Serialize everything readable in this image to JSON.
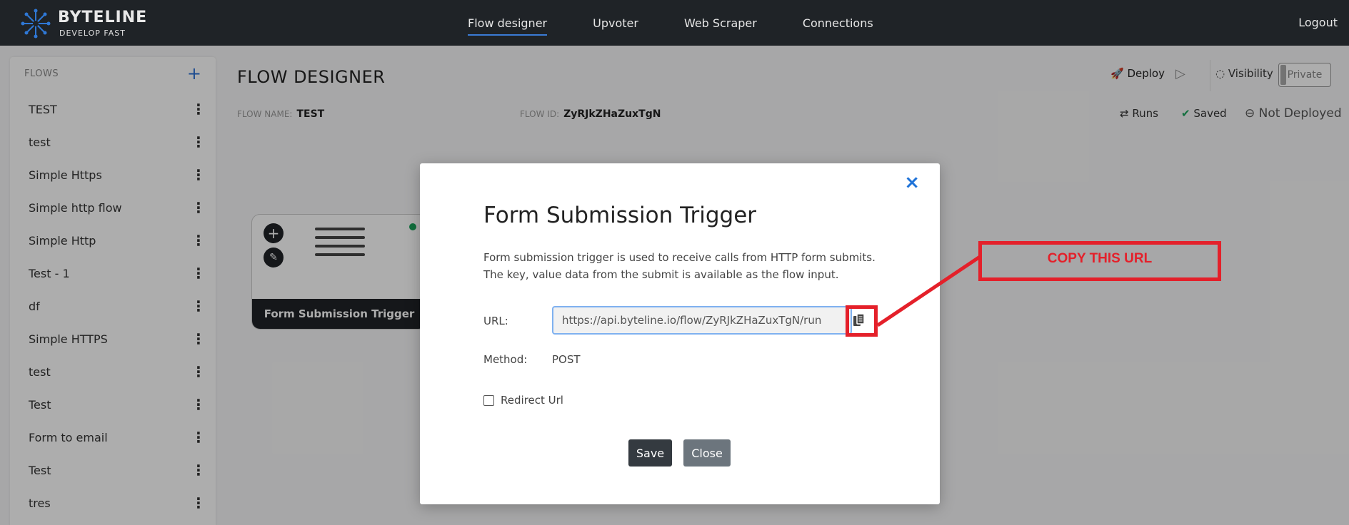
{
  "app": {
    "brand": "BYTELINE",
    "tagline": "DEVELOP FAST"
  },
  "nav": {
    "items": [
      {
        "label": "Flow designer",
        "active": true
      },
      {
        "label": "Upvoter",
        "active": false
      },
      {
        "label": "Web Scraper",
        "active": false
      },
      {
        "label": "Connections",
        "active": false
      }
    ],
    "logout": "Logout"
  },
  "sidebar": {
    "heading": "FLOWS",
    "add": "+",
    "flows": [
      "TEST",
      "test",
      "Simple Https",
      "Simple http flow",
      "Simple Http",
      "Test - 1",
      "df",
      "Simple HTTPS",
      "test",
      "Test",
      "Form to email",
      "Test",
      "tres"
    ]
  },
  "designer": {
    "title": "FLOW DESIGNER",
    "flow_name_label": "FLOW NAME:",
    "flow_name": "TEST",
    "flow_id_label": "FLOW ID:",
    "flow_id": "ZyRJkZHaZuxTgN",
    "deploy": "Deploy",
    "visibility": "Visibility",
    "private": "Private",
    "runs": "Runs",
    "saved": "Saved",
    "not_deployed": "Not Deployed",
    "node_label": "Form Submission Trigger"
  },
  "modal": {
    "close_x": "×",
    "title": "Form Submission Trigger",
    "desc_line1": "Form submission trigger is used to receive calls from HTTP form submits.",
    "desc_line2": "The key, value data from the submit is available as the flow input.",
    "url_label": "URL:",
    "url_value": "https://api.byteline.io/flow/ZyRJkZHaZuxTgN/run",
    "method_label": "Method:",
    "method_value": "POST",
    "redirect_label": "Redirect Url",
    "save": "Save",
    "close": "Close"
  },
  "annotation": {
    "text": "COPY THIS URL",
    "color": "#e4202a"
  },
  "colors": {
    "topbar": "#1f2327",
    "accent": "#1f73d8",
    "annotation": "#e4202a"
  }
}
